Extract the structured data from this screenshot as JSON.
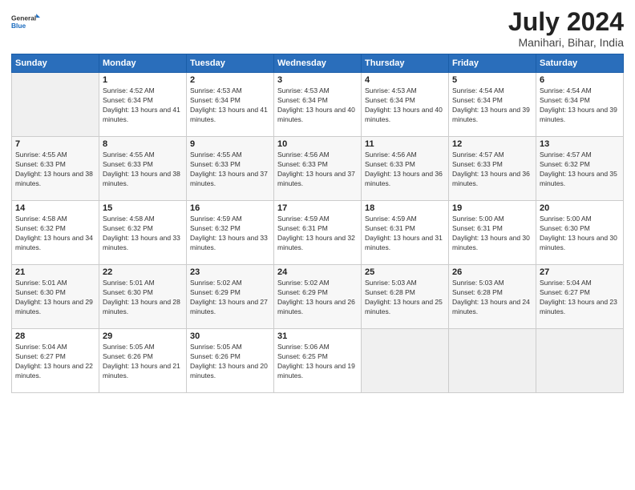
{
  "header": {
    "logo_general": "General",
    "logo_blue": "Blue",
    "month_title": "July 2024",
    "location": "Manihari, Bihar, India"
  },
  "days_of_week": [
    "Sunday",
    "Monday",
    "Tuesday",
    "Wednesday",
    "Thursday",
    "Friday",
    "Saturday"
  ],
  "weeks": [
    [
      {
        "day": "",
        "empty": true
      },
      {
        "day": "1",
        "sunrise": "4:52 AM",
        "sunset": "6:34 PM",
        "daylight": "13 hours and 41 minutes."
      },
      {
        "day": "2",
        "sunrise": "4:53 AM",
        "sunset": "6:34 PM",
        "daylight": "13 hours and 41 minutes."
      },
      {
        "day": "3",
        "sunrise": "4:53 AM",
        "sunset": "6:34 PM",
        "daylight": "13 hours and 40 minutes."
      },
      {
        "day": "4",
        "sunrise": "4:53 AM",
        "sunset": "6:34 PM",
        "daylight": "13 hours and 40 minutes."
      },
      {
        "day": "5",
        "sunrise": "4:54 AM",
        "sunset": "6:34 PM",
        "daylight": "13 hours and 39 minutes."
      },
      {
        "day": "6",
        "sunrise": "4:54 AM",
        "sunset": "6:34 PM",
        "daylight": "13 hours and 39 minutes."
      }
    ],
    [
      {
        "day": "7",
        "sunrise": "4:55 AM",
        "sunset": "6:33 PM",
        "daylight": "13 hours and 38 minutes."
      },
      {
        "day": "8",
        "sunrise": "4:55 AM",
        "sunset": "6:33 PM",
        "daylight": "13 hours and 38 minutes."
      },
      {
        "day": "9",
        "sunrise": "4:55 AM",
        "sunset": "6:33 PM",
        "daylight": "13 hours and 37 minutes."
      },
      {
        "day": "10",
        "sunrise": "4:56 AM",
        "sunset": "6:33 PM",
        "daylight": "13 hours and 37 minutes."
      },
      {
        "day": "11",
        "sunrise": "4:56 AM",
        "sunset": "6:33 PM",
        "daylight": "13 hours and 36 minutes."
      },
      {
        "day": "12",
        "sunrise": "4:57 AM",
        "sunset": "6:33 PM",
        "daylight": "13 hours and 36 minutes."
      },
      {
        "day": "13",
        "sunrise": "4:57 AM",
        "sunset": "6:32 PM",
        "daylight": "13 hours and 35 minutes."
      }
    ],
    [
      {
        "day": "14",
        "sunrise": "4:58 AM",
        "sunset": "6:32 PM",
        "daylight": "13 hours and 34 minutes."
      },
      {
        "day": "15",
        "sunrise": "4:58 AM",
        "sunset": "6:32 PM",
        "daylight": "13 hours and 33 minutes."
      },
      {
        "day": "16",
        "sunrise": "4:59 AM",
        "sunset": "6:32 PM",
        "daylight": "13 hours and 33 minutes."
      },
      {
        "day": "17",
        "sunrise": "4:59 AM",
        "sunset": "6:31 PM",
        "daylight": "13 hours and 32 minutes."
      },
      {
        "day": "18",
        "sunrise": "4:59 AM",
        "sunset": "6:31 PM",
        "daylight": "13 hours and 31 minutes."
      },
      {
        "day": "19",
        "sunrise": "5:00 AM",
        "sunset": "6:31 PM",
        "daylight": "13 hours and 30 minutes."
      },
      {
        "day": "20",
        "sunrise": "5:00 AM",
        "sunset": "6:30 PM",
        "daylight": "13 hours and 30 minutes."
      }
    ],
    [
      {
        "day": "21",
        "sunrise": "5:01 AM",
        "sunset": "6:30 PM",
        "daylight": "13 hours and 29 minutes."
      },
      {
        "day": "22",
        "sunrise": "5:01 AM",
        "sunset": "6:30 PM",
        "daylight": "13 hours and 28 minutes."
      },
      {
        "day": "23",
        "sunrise": "5:02 AM",
        "sunset": "6:29 PM",
        "daylight": "13 hours and 27 minutes."
      },
      {
        "day": "24",
        "sunrise": "5:02 AM",
        "sunset": "6:29 PM",
        "daylight": "13 hours and 26 minutes."
      },
      {
        "day": "25",
        "sunrise": "5:03 AM",
        "sunset": "6:28 PM",
        "daylight": "13 hours and 25 minutes."
      },
      {
        "day": "26",
        "sunrise": "5:03 AM",
        "sunset": "6:28 PM",
        "daylight": "13 hours and 24 minutes."
      },
      {
        "day": "27",
        "sunrise": "5:04 AM",
        "sunset": "6:27 PM",
        "daylight": "13 hours and 23 minutes."
      }
    ],
    [
      {
        "day": "28",
        "sunrise": "5:04 AM",
        "sunset": "6:27 PM",
        "daylight": "13 hours and 22 minutes."
      },
      {
        "day": "29",
        "sunrise": "5:05 AM",
        "sunset": "6:26 PM",
        "daylight": "13 hours and 21 minutes."
      },
      {
        "day": "30",
        "sunrise": "5:05 AM",
        "sunset": "6:26 PM",
        "daylight": "13 hours and 20 minutes."
      },
      {
        "day": "31",
        "sunrise": "5:06 AM",
        "sunset": "6:25 PM",
        "daylight": "13 hours and 19 minutes."
      },
      {
        "day": "",
        "empty": true
      },
      {
        "day": "",
        "empty": true
      },
      {
        "day": "",
        "empty": true
      }
    ]
  ]
}
